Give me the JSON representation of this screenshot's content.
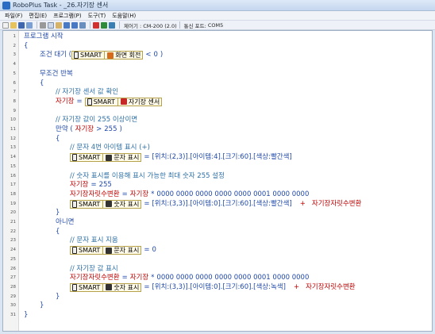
{
  "window": {
    "title": "RoboPlus Task - _26.자기장 센서"
  },
  "menu": [
    "파일(F)",
    "편집(E)",
    "프로그램(P)",
    "도구(T)",
    "도움말(H)"
  ],
  "toolbar": {
    "controller_label": "제어기 : CM-200 (2.0)",
    "port_label": "통신 포트:",
    "port_value": "COM5"
  },
  "code": {
    "l1": "프로그램 시작",
    "l2": "{",
    "l3_kw": "조건 대기 (",
    "l3_dev": "SMART",
    "l3_func": "화면 회전",
    "l3_op": "<",
    "l3_val": "0",
    "l3_end": ")",
    "l5": "무조건 반복",
    "l6": "{",
    "l7": "// 자기장 센서 값 확인",
    "l8_var": "자기장",
    "l8_op": "=",
    "l8_dev": "SMART",
    "l8_func": "자기장 센서",
    "l10": "// 자기장 값이 255 이상이면",
    "l11_kw": "만약 (",
    "l11_var": "자기장",
    "l11_op": ">",
    "l11_val": "255",
    "l11_end": ")",
    "l12": "{",
    "l13": "// 문자 4번 아이템 표시 (+)",
    "l14_dev": "SMART",
    "l14_func": "문자 표시",
    "l14_op": "=",
    "l14_val": "[위치:(2,3)].[아이템:4].[크기:60].[색상:빨간색]",
    "l16": "// 숫자 표시를 이용해 표시 가능한 최대 숫자 255 설정",
    "l17_var": "자기장",
    "l17_op": "=",
    "l17_val": "255",
    "l18_var": "자기장자릿수변환",
    "l18_op": "=",
    "l18_var2": "자기장",
    "l18_op2": "*",
    "l18_val": "0000 0000 0000 0000 0000 0001 0000 0000",
    "l19_dev": "SMART",
    "l19_func": "숫자 표시",
    "l19_op": "=",
    "l19_val": "[위치:(3,3)].[아이템:0].[크기:60].[색상:빨간색]",
    "l19_op2": "+",
    "l19_var": "자기장자릿수변환",
    "l20": "}",
    "l21": "아니면",
    "l22": "{",
    "l23": "// 문자 표시 지움",
    "l24_dev": "SMART",
    "l24_func": "문자 표시",
    "l24_op": "=",
    "l24_val": "0",
    "l26": "// 자기장 값 표시",
    "l27_var": "자기장자릿수변환",
    "l27_op": "=",
    "l27_var2": "자기장",
    "l27_op2": "*",
    "l27_val": "0000 0000 0000 0000 0000 0001 0000 0000",
    "l28_dev": "SMART",
    "l28_func": "숫자 표시",
    "l28_op": "=",
    "l28_val": "[위치:(3,3)].[아이템:0].[크기:60].[색상:녹색]",
    "l28_op2": "+",
    "l28_var": "자기장자릿수변환",
    "l29": "}",
    "l30": "}",
    "l31": "}"
  }
}
